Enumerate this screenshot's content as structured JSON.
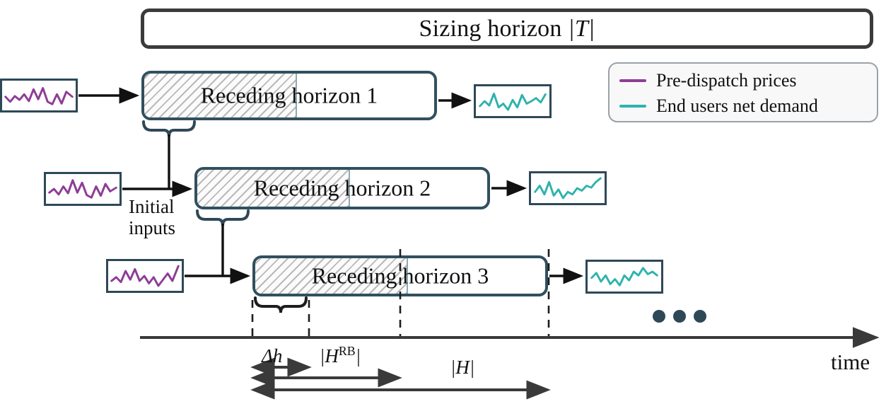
{
  "figure": {
    "kind": "receding-horizon-timeline-diagram",
    "sizing_horizon": {
      "label_prefix": "Sizing horizon ",
      "symbol": "|T|",
      "full_label": "Sizing horizon |T|"
    },
    "legend": {
      "items": [
        {
          "label": "Pre-dispatch prices",
          "color": "#8e3d96",
          "icon": "line-swatch"
        },
        {
          "label": "End users net demand",
          "color": "#2fb3ac",
          "icon": "line-swatch"
        }
      ]
    },
    "horizons": [
      {
        "id": 1,
        "label_hatched": "Receding",
        "label_tail": " horizon 1",
        "full_label": "Receding horizon 1"
      },
      {
        "id": 2,
        "label_hatched": "Receding",
        "label_tail": " horizon 2",
        "full_label": "Receding horizon 2"
      },
      {
        "id": 3,
        "label_hatched": "Receding",
        "label_tail": " horizon 3",
        "full_label": "Receding horizon 3"
      }
    ],
    "input_signal_name": "Pre-dispatch prices",
    "output_signal_name": "End users net demand",
    "initial_inputs_label_line1": "Initial",
    "initial_inputs_label_line2": "inputs",
    "continuation_marker": "• • •",
    "time_axis_label": "time",
    "spans": [
      {
        "name": "delta-h",
        "label_text": "Δh",
        "math": "Δh"
      },
      {
        "name": "h-rb",
        "label_text": "|H^RB|",
        "base": "|H",
        "sup": "RB",
        "close": "|"
      },
      {
        "name": "h-total",
        "label_text": "|H|",
        "base": "|H|"
      }
    ],
    "colors": {
      "horizon_border": "#31505f",
      "sizing_border": "#3b3b3b",
      "signal_border": "#2e4858",
      "prices_line": "#8e3d96",
      "demand_line": "#2fb3ac",
      "hatch": "#b9b9b9",
      "axis": "#3a3a3a",
      "dots": "#2e4858",
      "legend_border": "#9aa2a8"
    }
  }
}
